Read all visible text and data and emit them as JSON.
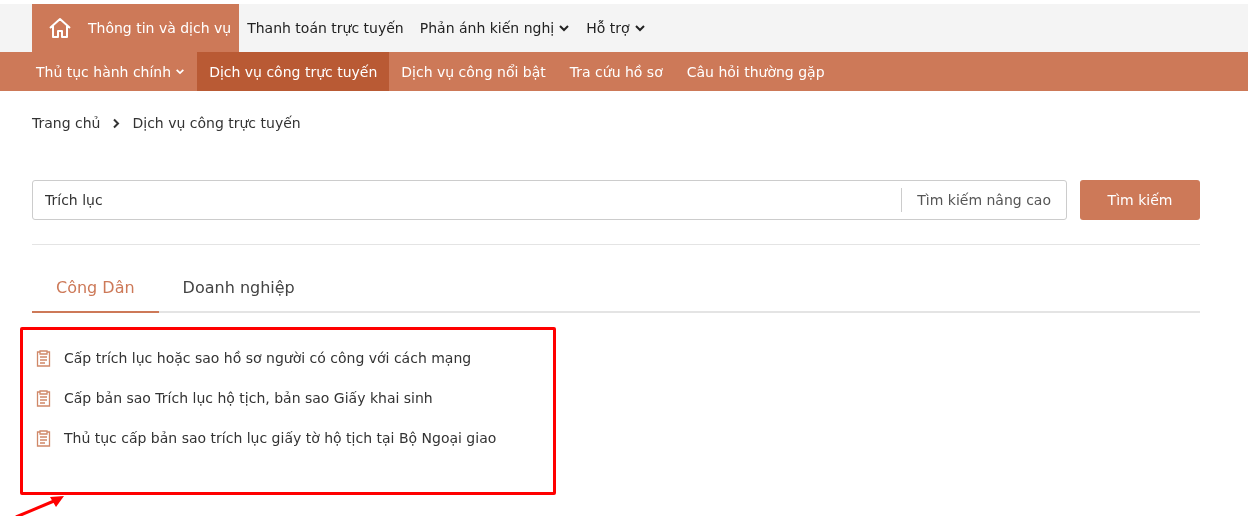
{
  "top_nav": {
    "items": [
      {
        "label": "Thông tin và dịch vụ",
        "selected": true,
        "dropdown": false
      },
      {
        "label": "Thanh toán trực tuyến",
        "selected": false,
        "dropdown": false
      },
      {
        "label": "Phản ánh kiến nghị",
        "selected": false,
        "dropdown": true
      },
      {
        "label": "Hỗ trợ",
        "selected": false,
        "dropdown": true
      }
    ]
  },
  "sub_nav": {
    "items": [
      {
        "label": "Thủ tục hành chính",
        "selected": false,
        "dropdown": true
      },
      {
        "label": "Dịch vụ công trực tuyến",
        "selected": true,
        "dropdown": false
      },
      {
        "label": "Dịch vụ công nổi bật",
        "selected": false,
        "dropdown": false
      },
      {
        "label": "Tra cứu hồ sơ",
        "selected": false,
        "dropdown": false
      },
      {
        "label": "Câu hỏi thường gặp",
        "selected": false,
        "dropdown": false
      }
    ]
  },
  "breadcrumb": [
    "Trang chủ",
    "Dịch vụ công trực tuyến"
  ],
  "search": {
    "value": "Trích lục",
    "advanced": "Tìm kiếm nâng cao",
    "button": "Tìm kiếm"
  },
  "tabs": [
    {
      "label": "Công Dân",
      "selected": true
    },
    {
      "label": "Doanh nghiệp",
      "selected": false
    }
  ],
  "results": {
    "highlighted": true,
    "items": [
      "Cấp trích lục hoặc sao hồ sơ người có công với cách mạng",
      "Cấp bản sao Trích lục hộ tịch, bản sao Giấy khai sinh",
      "Thủ tục cấp bản sao trích lục giấy tờ hộ tịch tại Bộ Ngoại giao"
    ]
  }
}
